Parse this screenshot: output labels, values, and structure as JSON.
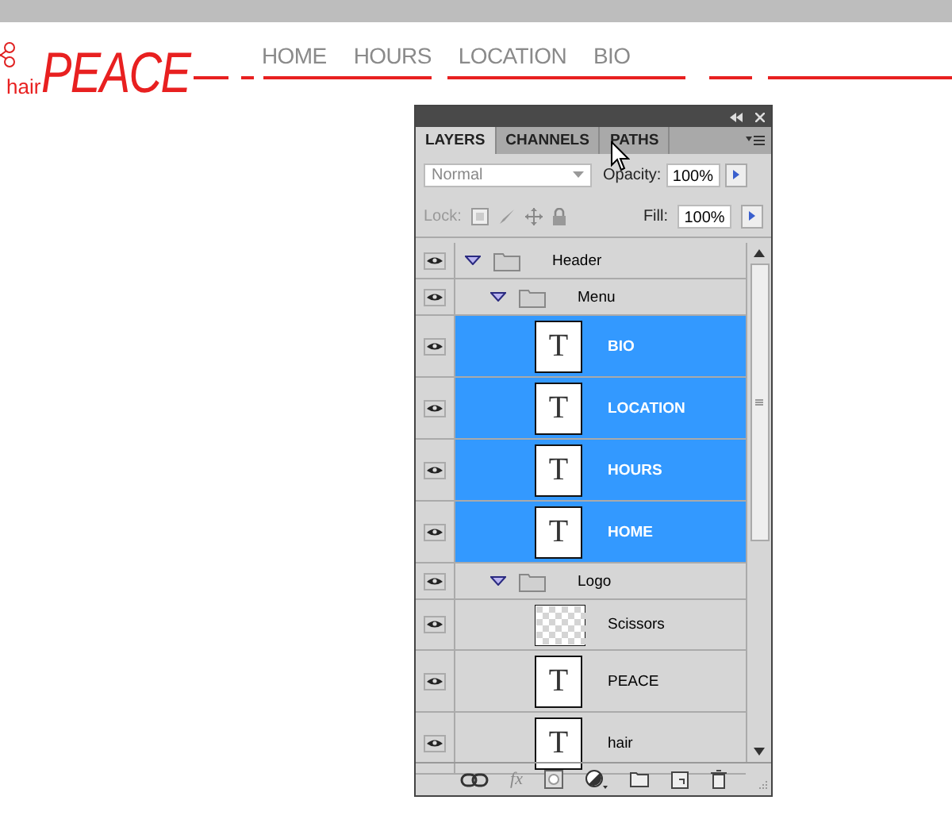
{
  "site": {
    "logo_small": "hair",
    "logo_big": "PEACE",
    "nav": [
      "HOME",
      "HOURS",
      "LOCATION",
      "BIO"
    ]
  },
  "panel": {
    "tabs": [
      {
        "label": "LAYERS",
        "selected": true
      },
      {
        "label": "CHANNELS",
        "selected": false
      },
      {
        "label": "PATHS",
        "selected": false
      }
    ],
    "fx_label": "fx",
    "blend_mode": "Normal",
    "opacity_label": "Opacity:",
    "opacity": "100%",
    "lock_label": "Lock:",
    "fill_label": "Fill:",
    "fill": "100%",
    "layers": [
      {
        "name": "Header",
        "kind": "folder",
        "visible": true,
        "expanded": true,
        "selected": false,
        "children": [
          {
            "name": "Menu",
            "kind": "folder",
            "visible": true,
            "expanded": true,
            "selected": false,
            "children": [
              {
                "name": "BIO",
                "kind": "text",
                "thumb": "T",
                "visible": true,
                "selected": true
              },
              {
                "name": "LOCATION",
                "kind": "text",
                "thumb": "T",
                "visible": true,
                "selected": true
              },
              {
                "name": "HOURS",
                "kind": "text",
                "thumb": "T",
                "visible": true,
                "selected": true
              },
              {
                "name": "HOME",
                "kind": "text",
                "thumb": "T",
                "visible": true,
                "selected": true
              }
            ]
          },
          {
            "name": "Logo",
            "kind": "folder",
            "visible": true,
            "expanded": true,
            "selected": false,
            "children": [
              {
                "name": "Scissors",
                "kind": "image",
                "visible": true,
                "selected": false
              },
              {
                "name": "PEACE",
                "kind": "text",
                "thumb": "T",
                "visible": true,
                "selected": false
              },
              {
                "name": "hair",
                "kind": "text",
                "thumb": "T",
                "visible": true,
                "selected": false
              }
            ]
          }
        ]
      }
    ]
  }
}
